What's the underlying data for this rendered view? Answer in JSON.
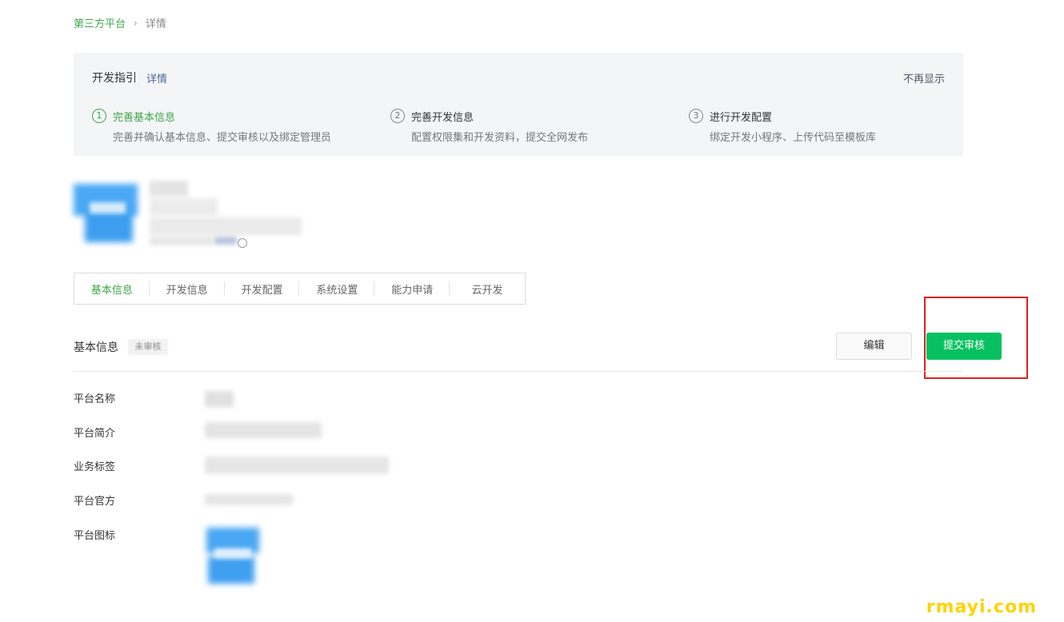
{
  "breadcrumb": {
    "parent": "第三方平台",
    "separator": "›",
    "current": "详情"
  },
  "guide": {
    "title": "开发指引",
    "detail_link": "详情",
    "hide_link": "不再显示",
    "steps": [
      {
        "number": "1",
        "title": "完善基本信息",
        "desc": "完善并确认基本信息、提交审核以及绑定管理员"
      },
      {
        "number": "2",
        "title": "完善开发信息",
        "desc": "配置权限集和开发资料，提交全网发布"
      },
      {
        "number": "3",
        "title": "进行开发配置",
        "desc": "绑定开发小程序、上传代码至模板库"
      }
    ]
  },
  "tabs": [
    "基本信息",
    "开发信息",
    "开发配置",
    "系统设置",
    "能力申请",
    "云开发"
  ],
  "section": {
    "title": "基本信息",
    "status_badge": "未审核"
  },
  "buttons": {
    "edit": "编辑",
    "submit": "提交审核"
  },
  "fields": [
    "平台名称",
    "平台简介",
    "业务标签",
    "平台官方",
    "平台图标"
  ],
  "watermark": "rmayi.com",
  "colors": {
    "accent": "#07c160",
    "link_green": "#3ca64a",
    "highlight": "#e02020"
  }
}
